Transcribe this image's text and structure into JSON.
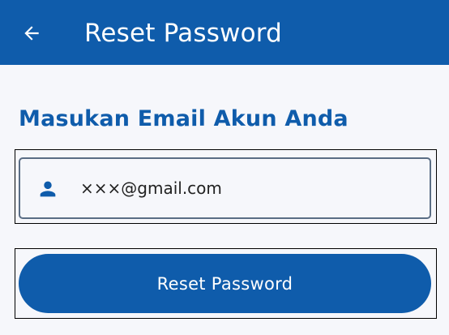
{
  "appbar": {
    "title": "Reset Password",
    "back_icon": "arrow-left-icon",
    "background_color": "#0f5cab"
  },
  "form": {
    "heading": "Masukan Email Akun Anda",
    "email_field": {
      "icon": "person-icon",
      "value": "×××@gmail.com"
    },
    "submit_label": "Reset Password",
    "accent_color": "#0f5cab"
  }
}
